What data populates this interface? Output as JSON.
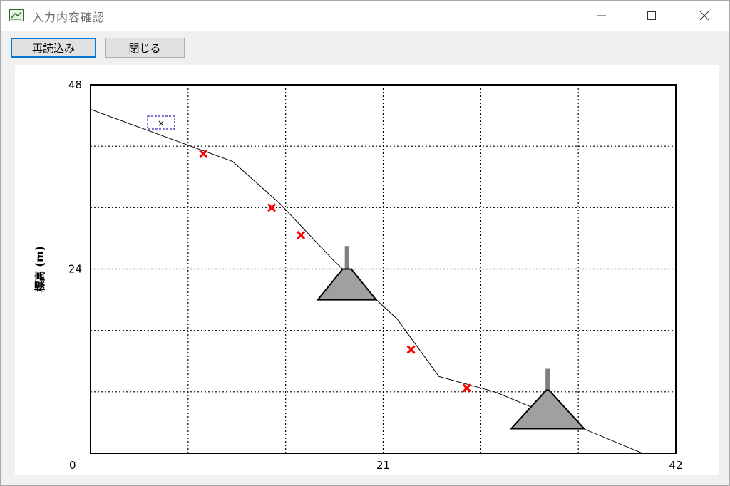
{
  "window": {
    "title": "入力内容確認"
  },
  "toolbar": {
    "reload_label": "再読込み",
    "close_label": "閉じる"
  },
  "chart_data": {
    "type": "line",
    "title": "",
    "xlabel": "",
    "ylabel": "標高 (m)",
    "xlim": [
      0,
      42
    ],
    "ylim": [
      0,
      48
    ],
    "x_ticks_labeled": [
      0,
      21,
      42
    ],
    "y_ticks_labeled": [
      0,
      24,
      48
    ],
    "x_gridlines": [
      7,
      14,
      21,
      28,
      35
    ],
    "y_gridlines": [
      8,
      16,
      24,
      32,
      40
    ],
    "grid": true,
    "profile": [
      {
        "x": 0.0,
        "y": 44.8
      },
      {
        "x": 10.2,
        "y": 38.0
      },
      {
        "x": 13.6,
        "y": 32.5
      },
      {
        "x": 17.5,
        "y": 25.0
      },
      {
        "x": 22.0,
        "y": 17.5
      },
      {
        "x": 25.0,
        "y": 10.0
      },
      {
        "x": 29.0,
        "y": 8.0
      },
      {
        "x": 39.6,
        "y": 0.0
      }
    ],
    "markers": [
      {
        "x": 8.1,
        "y": 39.0
      },
      {
        "x": 13.0,
        "y": 32.0
      },
      {
        "x": 15.1,
        "y": 28.4
      },
      {
        "x": 23.0,
        "y": 13.5
      },
      {
        "x": 27.0,
        "y": 8.5
      }
    ],
    "structures": [
      {
        "name": "small-structure",
        "x": 18.4,
        "base_y": 20.0,
        "top_y": 24.0,
        "pole_top_y": 27.0
      },
      {
        "name": "large-structure",
        "x": 32.8,
        "base_y": 3.2,
        "top_y": 8.2,
        "pole_top_y": 11.0
      }
    ],
    "legend_marker": "×",
    "colors": {
      "line": "#000000",
      "marker": "#ff0000",
      "structure_fill": "#a0a0a0",
      "grid": "#000000",
      "legend_box": "#2b2bb5"
    }
  }
}
